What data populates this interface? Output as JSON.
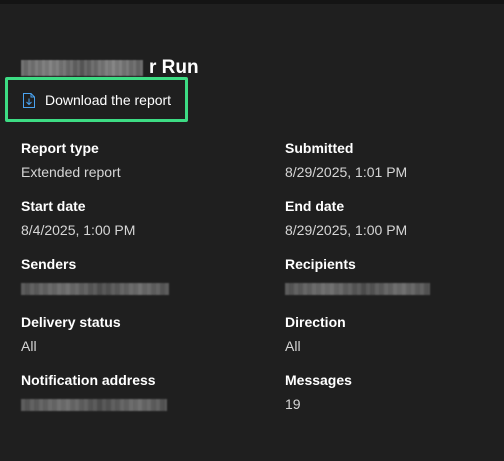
{
  "panel": {
    "title_suffix": "r Run",
    "download_label": "Download the report"
  },
  "fields": {
    "report_type": {
      "label": "Report type",
      "value": "Extended report"
    },
    "submitted": {
      "label": "Submitted",
      "value": "8/29/2025, 1:01 PM"
    },
    "start_date": {
      "label": "Start date",
      "value": "8/4/2025, 1:00 PM"
    },
    "end_date": {
      "label": "End date",
      "value": "8/29/2025, 1:00 PM"
    },
    "senders": {
      "label": "Senders"
    },
    "recipients": {
      "label": "Recipients"
    },
    "delivery_status": {
      "label": "Delivery status",
      "value": "All"
    },
    "direction": {
      "label": "Direction",
      "value": "All"
    },
    "notification_address": {
      "label": "Notification address"
    },
    "messages": {
      "label": "Messages",
      "value": "19"
    }
  },
  "colors": {
    "background": "#1f1f1f",
    "highlight": "#3ddc84",
    "icon_accent": "#4aa3f0"
  },
  "icons": {
    "download": "file-download-icon"
  }
}
